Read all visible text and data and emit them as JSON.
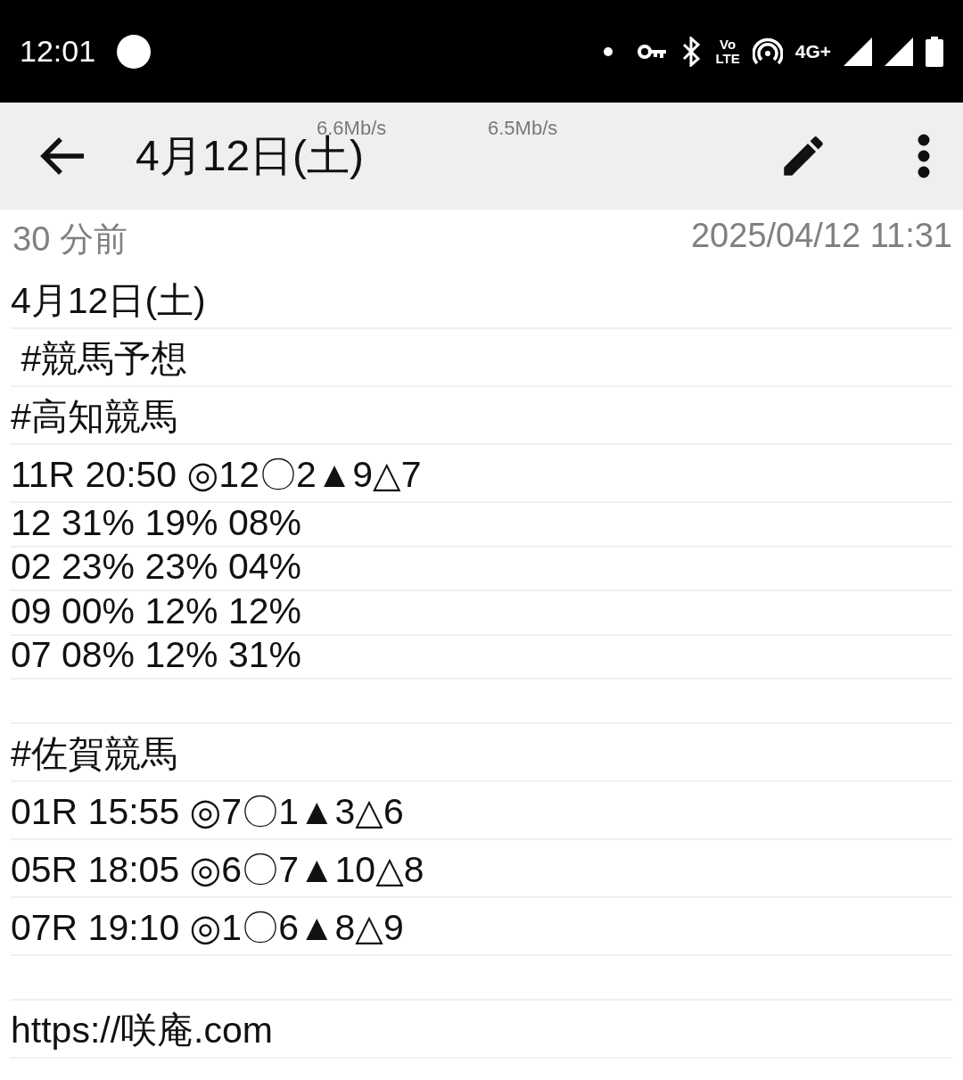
{
  "status_bar": {
    "time": "12:01",
    "volte": [
      "Vo",
      "LTE"
    ],
    "network": "4G+"
  },
  "speed_overlay": [
    "6.6Mb/s",
    "6.5Mb/s"
  ],
  "app_bar": {
    "title": "4月12日(土)"
  },
  "meta": {
    "relative": "30 分前",
    "timestamp": "2025/04/12 11:31"
  },
  "note": [
    {
      "kind": "text",
      "text": "4月12日(土)"
    },
    {
      "kind": "text",
      "text": " #競馬予想"
    },
    {
      "kind": "text",
      "text": "#高知競馬"
    },
    {
      "kind": "text",
      "text": "11R 20:50 ◎12〇2▲9△7"
    },
    {
      "kind": "table",
      "rows": [
        "12 31% 19% 08%",
        "02 23% 23% 04%",
        "09 00% 12% 12%",
        "07 08% 12% 31%"
      ]
    },
    {
      "kind": "blank"
    },
    {
      "kind": "text",
      "text": "#佐賀競馬"
    },
    {
      "kind": "text",
      "text": "01R 15:55 ◎7〇1▲3△6"
    },
    {
      "kind": "text",
      "text": "05R 18:05 ◎6〇7▲10△8"
    },
    {
      "kind": "text",
      "text": "07R 19:10 ◎1〇6▲8△9"
    },
    {
      "kind": "blank"
    },
    {
      "kind": "text",
      "text": "https://咲庵.com"
    }
  ]
}
